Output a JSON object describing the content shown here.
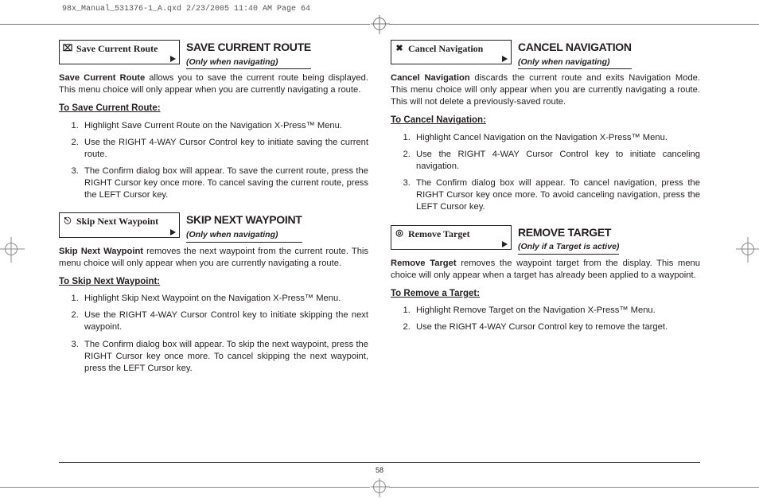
{
  "header_line": "98x_Manual_531376-1_A.qxd  2/23/2005  11:40 AM  Page 64",
  "page_number": "58",
  "sections": {
    "save_route": {
      "menu_label": "Save Current Route",
      "icon": "⌧",
      "title": "SAVE CURRENT ROUTE",
      "subtitle": "(Only when navigating)",
      "lead_bold": "Save Current Route",
      "lead_rest": " allows you to save the current route being displayed. This menu choice will only appear when you are currently navigating a route.",
      "steps_header": "To Save Current Route:",
      "steps": [
        "Highlight Save Current Route on the Navigation X-Press™ Menu.",
        "Use the RIGHT 4-WAY Cursor Control key to initiate saving the current route.",
        "The Confirm dialog box will appear. To save the current route, press the RIGHT Cursor key once more. To cancel saving the current route, press the LEFT Cursor key."
      ]
    },
    "skip_wp": {
      "menu_label": "Skip Next Waypoint",
      "icon": "⎋",
      "title": "SKIP NEXT WAYPOINT",
      "subtitle": "(Only when navigating)",
      "lead_bold": "Skip Next Waypoint",
      "lead_rest": " removes the next waypoint from the current route. This menu choice will only appear when you are currently navigating a route.",
      "steps_header": "To Skip Next Waypoint:",
      "steps": [
        "Highlight Skip Next Waypoint on the Navigation X-Press™ Menu.",
        "Use the RIGHT 4-WAY Cursor Control key to initiate skipping the next waypoint.",
        "The Confirm dialog box will appear. To skip the next waypoint, press the RIGHT Cursor key once more. To cancel skipping the next waypoint, press the LEFT Cursor key."
      ]
    },
    "cancel_nav": {
      "menu_label": "Cancel Navigation",
      "icon": "✖",
      "title": "CANCEL NAVIGATION",
      "subtitle": "(Only when navigating)",
      "lead_bold": "Cancel Navigation",
      "lead_rest": " discards the current route and exits Navigation Mode. This menu choice will only appear when you are currently navigating a route. This will not delete a previously-saved route.",
      "steps_header": "To Cancel Navigation:",
      "steps": [
        "Highlight Cancel Navigation on the Navigation X-Press™ Menu.",
        "Use the RIGHT 4-WAY Cursor Control key to initiate canceling navigation.",
        "The Confirm dialog box will appear. To cancel navigation, press the RIGHT Cursor key once more. To avoid canceling navigation, press the LEFT Cursor key."
      ]
    },
    "remove_target": {
      "menu_label": "Remove Target",
      "icon": "◎",
      "title": "REMOVE TARGET",
      "subtitle": "(Only if a Target is active)",
      "lead_bold": "Remove Target",
      "lead_rest": " removes the waypoint target from the display. This menu choice will only appear when a target has already been applied to a waypoint.",
      "steps_header": "To Remove a Target:",
      "steps": [
        "Highlight Remove Target on the Navigation X-Press™ Menu.",
        "Use the RIGHT 4-WAY Cursor Control key to remove the target."
      ]
    }
  }
}
